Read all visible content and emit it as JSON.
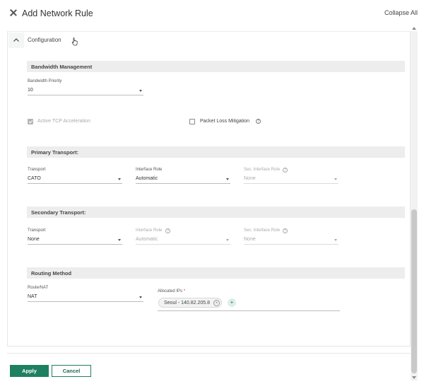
{
  "header": {
    "title": "Add Network Rule",
    "collapse_all": "Collapse All"
  },
  "config": {
    "section_label": "Configuration"
  },
  "bandwidth": {
    "title": "Bandwidth Management",
    "priority_label": "Bandwidth Priority",
    "priority_value": "10",
    "active_tcp_label": "Active TCP Acceleration",
    "active_tcp_checked": true,
    "packet_loss_label": "Packet Loss Mitigation",
    "packet_loss_checked": false
  },
  "primary": {
    "title": "Primary Transport:",
    "transport_label": "Transport",
    "transport_value": "CATO",
    "role_label": "Interface Role",
    "role_value": "Automatic",
    "sec_role_label": "Sec. Interface Role",
    "sec_role_value": "None"
  },
  "secondary": {
    "title": "Secondary Transport:",
    "transport_label": "Transport",
    "transport_value": "None",
    "role_label": "Interface Role",
    "role_value": "Automatic",
    "sec_role_label": "Sec. Interface Role",
    "sec_role_value": "None"
  },
  "routing": {
    "title": "Routing Method",
    "route_label": "Route/NAT",
    "route_value": "NAT",
    "allocated_label": "Allocated IPs",
    "required_mark": "*",
    "chip": "Seoul - 140.82.205.8",
    "add_symbol": "+",
    "remove_symbol": "×"
  },
  "help_symbol": "?",
  "footer": {
    "apply": "Apply",
    "cancel": "Cancel"
  },
  "colors": {
    "accent": "#1e8060"
  }
}
